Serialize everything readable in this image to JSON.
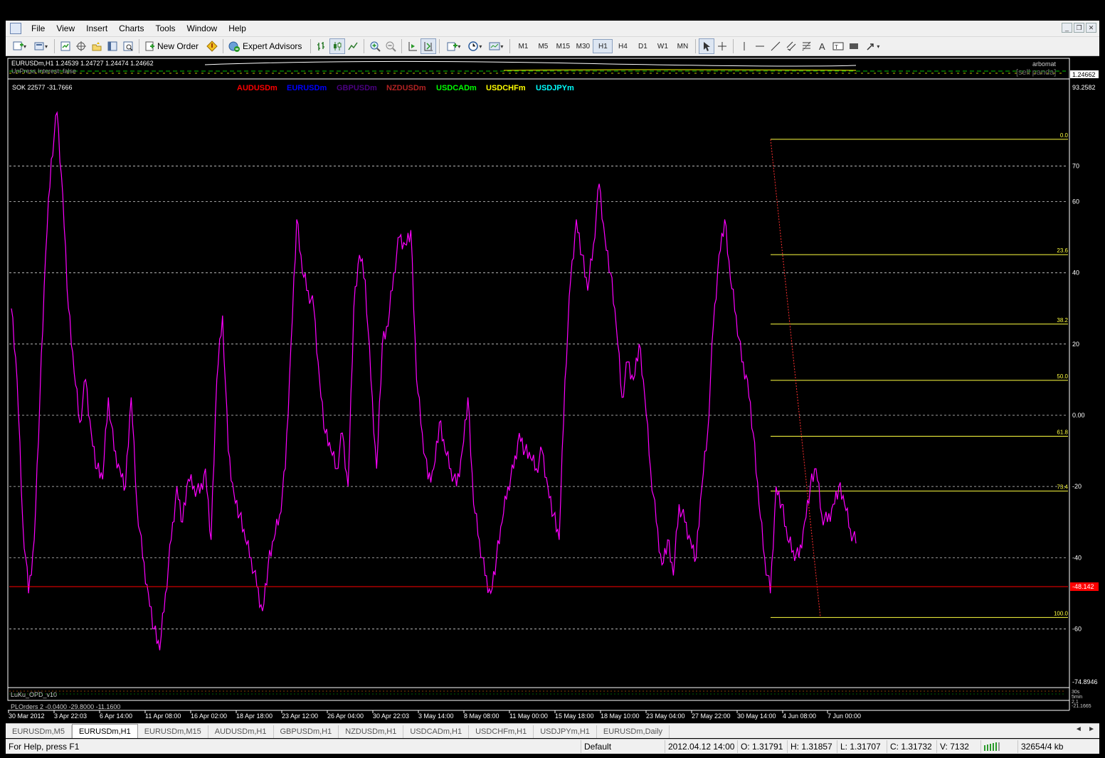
{
  "menu": {
    "items": [
      "File",
      "View",
      "Insert",
      "Charts",
      "Tools",
      "Window",
      "Help"
    ]
  },
  "toolbar": {
    "new_order": "New Order",
    "expert_advisors": "Expert Advisors",
    "timeframes": [
      "M1",
      "M5",
      "M15",
      "M30",
      "H1",
      "H4",
      "D1",
      "W1",
      "MN"
    ],
    "active_timeframe": "H1"
  },
  "chart": {
    "header": "EURUSDm,H1  1.24539 1.24727 1.24474 1.24662",
    "header_line2": "UnPress Interest: false",
    "broker_label": "arbomat",
    "sell_label": "[sell panda]",
    "price_right": "1.24662",
    "indicator_label": "SOK 22577 -31.7666",
    "legend": [
      {
        "name": "AUDUSDm",
        "color": "#ff0000"
      },
      {
        "name": "EURUSDm",
        "color": "#0000ff"
      },
      {
        "name": "GBPUSDm",
        "color": "#4b0082"
      },
      {
        "name": "NZDUSDm",
        "color": "#b22222"
      },
      {
        "name": "USDCADm",
        "color": "#00ff00"
      },
      {
        "name": "USDCHFm",
        "color": "#ffff00"
      },
      {
        "name": "USDJPYm",
        "color": "#00ffff"
      }
    ],
    "line_color": "#ff00ff",
    "fib_color": "#ffff40",
    "bottom_labels": [
      "LuKu_OPD_v10",
      "PLOrders 2 -0.0400 -29.8000 -11.1600"
    ],
    "small_right_labels": [
      "30s",
      "5min",
      "2,1",
      "-21.1665"
    ]
  },
  "chart_data": {
    "type": "line",
    "title": "",
    "xlabel": "",
    "ylabel": "",
    "ylim": [
      -74.8946,
      93.2582
    ],
    "top_label": "93.2582",
    "bottom_label": "-74.8946",
    "yticks": [
      70,
      60,
      40,
      20,
      0,
      -20,
      -40,
      -60
    ],
    "ytick_labels": [
      "70",
      "60",
      "40",
      "20",
      "0.00",
      "-20",
      "-40",
      "-60"
    ],
    "current_value": -48.142,
    "current_value_label": "-48.142",
    "x_labels": [
      "30 Mar 2012",
      "3 Apr 22:03",
      "6 Apr 14:00",
      "11 Apr 08:00",
      "16 Apr 02:00",
      "18 Apr 18:00",
      "23 Apr 12:00",
      "26 Apr 04:00",
      "30 Apr 22:03",
      "3 May 14:00",
      "8 May 08:00",
      "11 May 00:00",
      "15 May 18:00",
      "18 May 10:00",
      "23 May 04:00",
      "27 May 22:00",
      "30 May 14:00",
      "4 Jun 08:00",
      "7 Jun 00:00"
    ],
    "series": [
      {
        "values": [
          30,
          10,
          -30,
          -50,
          -35,
          5,
          45,
          72,
          85,
          62,
          30,
          12,
          -2,
          10,
          -5,
          -15,
          -18,
          5,
          -10,
          -15,
          -20,
          5,
          -25,
          -40,
          -50,
          -60,
          -66,
          -50,
          -35,
          -20,
          -30,
          -18,
          -20,
          -22,
          -15,
          -35,
          10,
          28,
          -10,
          -22,
          -28,
          -35,
          -40,
          -48,
          -55,
          -42,
          -35,
          -28,
          -15,
          20,
          55,
          40,
          35,
          30,
          10,
          -5,
          -10,
          -15,
          -5,
          -20,
          30,
          45,
          38,
          10,
          -15,
          20,
          25,
          40,
          50,
          48,
          52,
          10,
          -5,
          -18,
          -15,
          -2,
          -10,
          -15,
          -20,
          -10,
          5,
          -25,
          -35,
          -45,
          -50,
          -40,
          -30,
          -20,
          -15,
          -5,
          -10,
          -12,
          -15,
          -10,
          -20,
          -28,
          -35,
          10,
          38,
          55,
          45,
          35,
          48,
          65,
          50,
          40,
          25,
          5,
          15,
          10,
          20,
          5,
          -15,
          -30,
          -42,
          -35,
          -45,
          -25,
          -30,
          -35,
          -40,
          -20,
          -5,
          25,
          45,
          55,
          38,
          28,
          15,
          10,
          -5,
          -25,
          -40,
          -50,
          -20,
          -25,
          -35,
          -38,
          -40,
          -30,
          -20,
          -15,
          -28,
          -30,
          -25,
          -20,
          -25,
          -32,
          -36
        ],
        "color": "#ff00ff"
      }
    ],
    "fibonacci": {
      "levels": [
        {
          "label": "0.0",
          "value": 77.5
        },
        {
          "label": "23.6",
          "value": 45.1
        },
        {
          "label": "38.2",
          "value": 25.6
        },
        {
          "label": "50.0",
          "value": 9.8
        },
        {
          "label": "61.8",
          "value": -5.9
        },
        {
          "label": "73.4",
          "value": -21.3
        },
        {
          "label": "100.0",
          "value": -56.8
        }
      ]
    },
    "grid": true
  },
  "tabs": {
    "items": [
      "EURUSDm,M5",
      "EURUSDm,H1",
      "EURUSDm,M15",
      "AUDUSDm,H1",
      "GBPUSDm,H1",
      "NZDUSDm,H1",
      "USDCADm,H1",
      "USDCHFm,H1",
      "USDJPYm,H1",
      "EURUSDm,Daily"
    ],
    "active": "EURUSDm,H1"
  },
  "status": {
    "help": "For Help, press F1",
    "profile": "Default",
    "datetime": "2012.04.12 14:00",
    "open": "O: 1.31791",
    "high": "H: 1.31857",
    "low": "L: 1.31707",
    "close": "C: 1.31732",
    "volume": "V: 7132",
    "traffic": "32654/4 kb"
  }
}
